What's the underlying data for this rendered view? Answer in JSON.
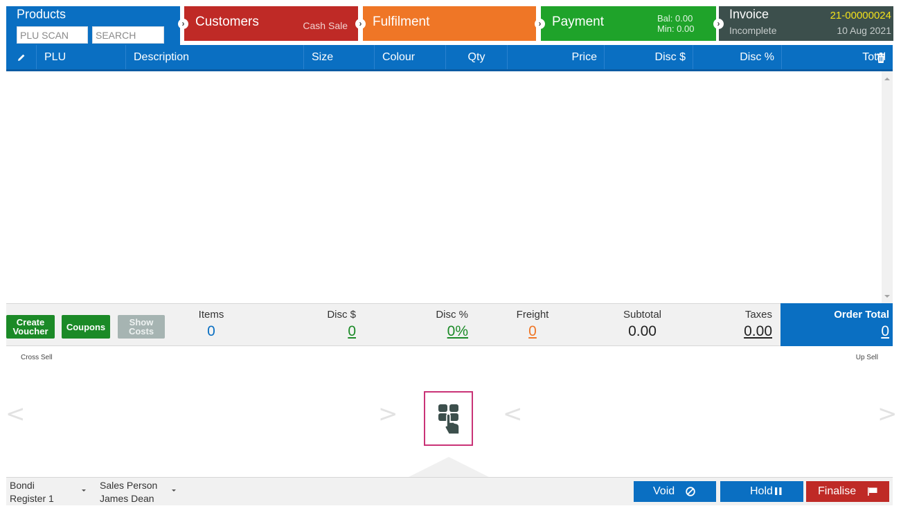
{
  "tabs": {
    "products": {
      "title": "Products",
      "plu_placeholder": "PLU SCAN",
      "search_placeholder": "SEARCH"
    },
    "customers": {
      "title": "Customers",
      "subtitle": "Cash Sale"
    },
    "fulfilment": {
      "title": "Fulfilment"
    },
    "payment": {
      "title": "Payment",
      "balance": "Bal:  0.00",
      "minimum": "Min:  0.00"
    },
    "invoice": {
      "title": "Invoice",
      "status": "Incomplete",
      "number": "21-00000024",
      "date": "10 Aug 2021"
    }
  },
  "table": {
    "columns": {
      "plu": "PLU",
      "description": "Description",
      "size": "Size",
      "colour": "Colour",
      "qty": "Qty",
      "price": "Price",
      "disc_amount": "Disc $",
      "disc_percent": "Disc %",
      "total": "Total"
    },
    "rows": []
  },
  "actions": {
    "create_voucher": "Create Voucher",
    "coupons": "Coupons",
    "show_costs": "Show Costs"
  },
  "totals": {
    "items": {
      "label": "Items",
      "value": "0"
    },
    "disc_amount": {
      "label": "Disc $",
      "value": "0"
    },
    "disc_percent": {
      "label": "Disc %",
      "value": "0%"
    },
    "freight": {
      "label": "Freight",
      "value": "0"
    },
    "subtotal": {
      "label": "Subtotal",
      "value": "0.00"
    },
    "taxes": {
      "label": "Taxes",
      "value": "0.00"
    },
    "order_total": {
      "label": "Order Total",
      "value": "0"
    }
  },
  "sell": {
    "cross_sell": "Cross Sell",
    "up_sell": "Up Sell"
  },
  "footer": {
    "location": "Bondi",
    "register": "Register 1",
    "salesperson_label": "Sales Person",
    "salesperson": "James Dean",
    "void": "Void",
    "hold": "Hold",
    "finalise": "Finalise"
  },
  "colors": {
    "products": "#0a6fc2",
    "customers": "#bf2a26",
    "fulfilment": "#ef7626",
    "payment": "#1fa32a",
    "invoice": "#3c4f4c",
    "invoice_number": "#f2e11c"
  },
  "icons": [
    "pencil-icon",
    "trash-icon",
    "keypad-icon",
    "void-icon",
    "pause-icon",
    "flag-icon",
    "chevron-right-icon",
    "chevron-left-icon"
  ]
}
